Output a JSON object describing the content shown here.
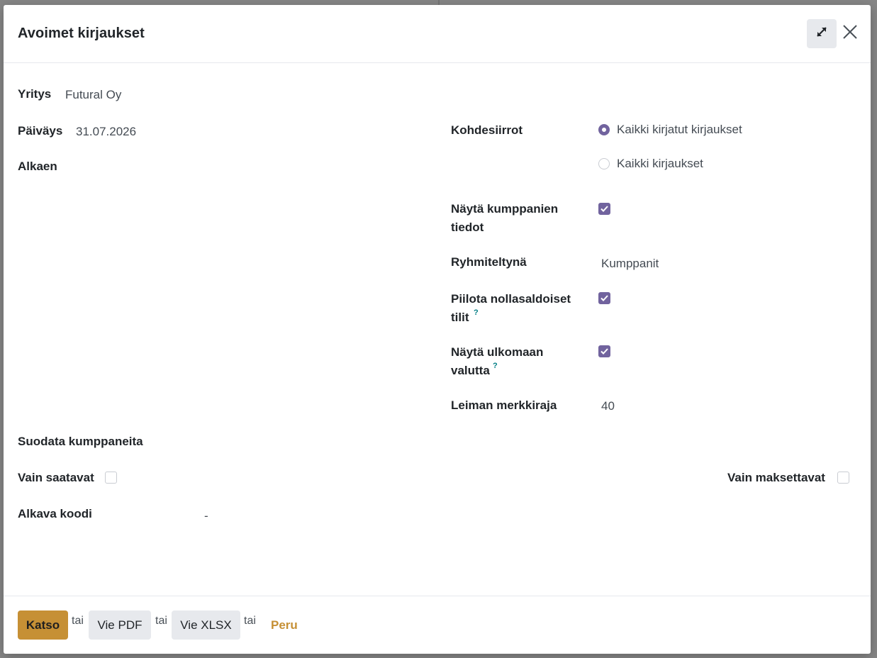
{
  "dialog": {
    "title": "Avoimet kirjaukset",
    "expand_icon": "expand-icon",
    "close_icon": "close-icon"
  },
  "form": {
    "company": {
      "label": "Yritys",
      "value": "Futural Oy"
    },
    "date": {
      "label": "Päiväys",
      "value": "31.07.2026"
    },
    "from": {
      "label": "Alkaen"
    },
    "target_moves": {
      "label": "Kohdesiirrot",
      "options": [
        {
          "label": "Kaikki kirjatut kirjaukset",
          "selected": true
        },
        {
          "label": "Kaikki kirjaukset",
          "selected": false
        }
      ]
    },
    "show_partner_details": {
      "label_line1": "Näytä kumppanien",
      "label_line2": "tiedot",
      "checked": true
    },
    "grouped_by": {
      "label": "Ryhmiteltynä",
      "value": "Kumppanit"
    },
    "hide_zero_accounts": {
      "label_line1": "Piilota nollasaldoiset",
      "label_line2": "tilit",
      "help": "?",
      "checked": true
    },
    "show_foreign_currency": {
      "label_line1": "Näytä ulkomaan",
      "label_line2": "valutta",
      "help": "?",
      "checked": true
    },
    "label_char_limit": {
      "label": "Leiman merkkiraja",
      "value": "40"
    },
    "filter_partners": {
      "label": "Suodata kumppaneita"
    },
    "only_receivables": {
      "label": "Vain saatavat",
      "checked": false
    },
    "only_payables": {
      "label": "Vain maksettavat",
      "checked": false
    },
    "starting_code": {
      "label": "Alkava koodi",
      "value": "-"
    }
  },
  "footer": {
    "view_label": "Katso",
    "or1": "tai",
    "pdf_label": "Vie PDF",
    "or2": "tai",
    "xlsx_label": "Vie XLSX",
    "or3": "tai",
    "cancel_label": "Peru"
  },
  "colors": {
    "primary": "#c69035",
    "accent": "#71639e",
    "help": "#017e84"
  }
}
